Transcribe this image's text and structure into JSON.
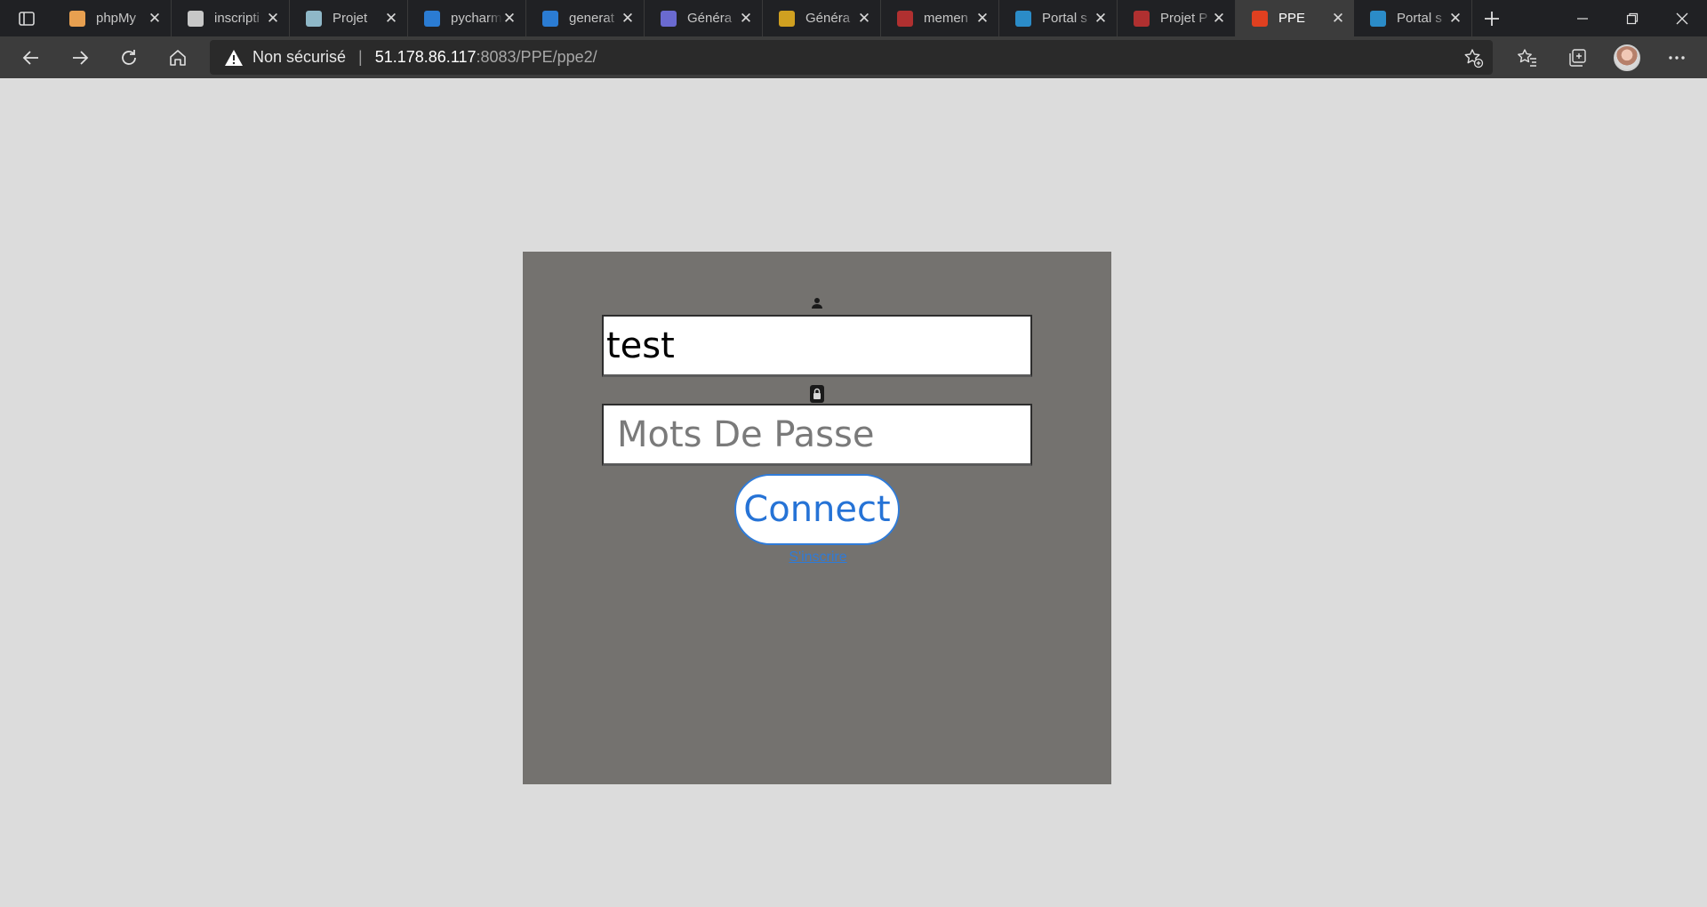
{
  "browser": {
    "tabs": [
      {
        "title": "phpMy",
        "favicon": "phpmyadmin-icon",
        "color": "#e8a050"
      },
      {
        "title": "inscripti",
        "favicon": "document-icon",
        "color": "#c7c7c7"
      },
      {
        "title": "Projet",
        "favicon": "avatar-icon",
        "color": "#8fb8c8"
      },
      {
        "title": "pycharm",
        "favicon": "bing-icon",
        "color": "#2b7cd3"
      },
      {
        "title": "generat",
        "favicon": "bing-icon",
        "color": "#2b7cd3"
      },
      {
        "title": "Généra",
        "favicon": "generator-icon",
        "color": "#6a6ad0"
      },
      {
        "title": "Généra",
        "favicon": "warning-icon",
        "color": "#d0a020"
      },
      {
        "title": "memen",
        "favicon": "pdf-icon",
        "color": "#b03030"
      },
      {
        "title": "Portal s",
        "favicon": "portal-icon",
        "color": "#2b8cc8"
      },
      {
        "title": "Projet P",
        "favicon": "pdf-icon",
        "color": "#b03030"
      },
      {
        "title": "PPE",
        "favicon": "ppe-icon",
        "color": "#e04020",
        "active": true
      },
      {
        "title": "Portal s",
        "favicon": "portal-icon",
        "color": "#2b8cc8"
      }
    ],
    "security_label": "Non sécurisé",
    "url_host": "51.178.86.117",
    "url_rest": ":8083/PPE/ppe2/"
  },
  "login": {
    "username_value": "test",
    "password_placeholder": "Mots De Passe",
    "connect_label": "Connect",
    "signup_label": "S'inscrire"
  },
  "colors": {
    "page_bg": "#dcdcdc",
    "panel_bg": "#74726f",
    "accent": "#2f7bd8"
  }
}
